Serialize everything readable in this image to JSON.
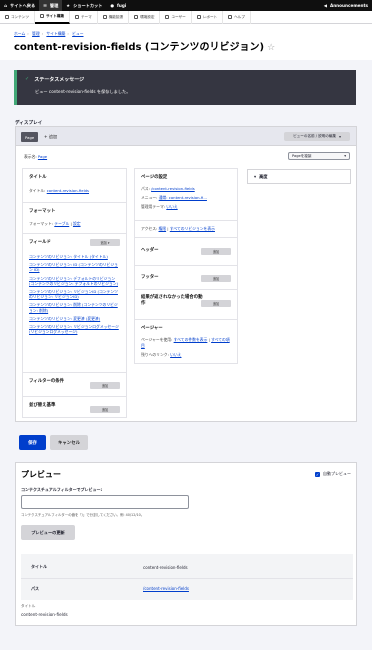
{
  "toolbar": {
    "back": "サイトへ戻る",
    "manage": "管理",
    "shortcuts": "ショートカット",
    "user": "fugi",
    "announcements": "Announcements"
  },
  "tray": [
    "コンテンツ",
    "サイト構築",
    "テーマ",
    "機能拡張",
    "環境設定",
    "ユーザー",
    "レポート",
    "ヘルプ"
  ],
  "breadcrumb": [
    "ホーム",
    "管理",
    "サイト構築",
    "ビュー"
  ],
  "page_title": "content-revision-fields (コンテンツのリビジョン)",
  "status": {
    "heading": "ステータスメッセージ",
    "body": "ビュー content-revision-fields を保存しました。"
  },
  "display_label": "ディスプレイ",
  "display_tab": "Page",
  "add_link": "+ 追加",
  "edit_view_dropdown": "ビューの名前 / 説明の編集",
  "display_name_label": "表示名:",
  "display_name_value": "Page",
  "page_dropdown": "Pageを複製",
  "left": {
    "title_section": "タイトル",
    "title_label": "タイトル:",
    "title_value": "content-revision-fields",
    "format_section": "フォーマット",
    "format_label": "フォーマット:",
    "format_value": "テーブル",
    "format_settings": "設定",
    "fields_section": "フィールド",
    "fields_add": "追加",
    "fields": [
      "コンテンツのリビジョン: タイトル (タイトル)",
      "コンテンツのリビジョン: ID (コンテンツのリビジョン ID)",
      "コンテンツのリビジョン: デフォルトのリビジョン (コンテンツのリビジョン: デフォルトのリビジョン)",
      "コンテンツのリビジョン: リビジョンID (コンテンツのリビジョン: リビジョンID)",
      "コンテンツのリビジョン: 削除 (コンテンツのリビジョン: 削除)",
      "コンテンツのリビジョン: 変更済 (変更済)",
      "コンテンツのリビジョン: リビジョンログメッセージ (リビジョンログメッセージ)"
    ],
    "filter_section": "フィルターの条件",
    "sort_section": "並び替え基準",
    "add": "追加"
  },
  "middle": {
    "page_settings": "ページの設定",
    "path_label": "パス:",
    "path_value": "/content-revision-fields",
    "menu_label": "メニュー:",
    "menu_value": "通常: content-revision-fi...",
    "theme_label": "管理用テーマ:",
    "theme_value": "いいえ",
    "access_label": "アクセス:",
    "access_value": "権限",
    "access_value2": "すべてのリビジョンを表示",
    "header_section": "ヘッダー",
    "footer_section": "フッター",
    "no_results_section": "結果が返されなかった場合の動作",
    "pager_section": "ページャー",
    "pager_label": "ページャーを使用:",
    "pager_value": "すべての件数を表示",
    "pager_value2": "すべての項目",
    "more_label": "残りへのリンク:",
    "more_value": "いいえ",
    "add": "追加"
  },
  "advanced": "高度",
  "save": "保存",
  "cancel": "キャンセル",
  "preview": {
    "heading": "プレビュー",
    "auto_preview": "自動プレビュー",
    "contextual_label": "コンテクスチュアルフィルターでプレビュー:",
    "contextual_help": "コンテクスチュアルフィルターの値を「/」で分割してください。例: 40/12/10。",
    "update": "プレビューの更新",
    "rows": [
      {
        "key": "タイトル",
        "value": "content-revision-fields"
      },
      {
        "key": "パス",
        "value": "/content-revision-fields"
      }
    ],
    "title_label": "タイトル",
    "title_value": "content-revision-fields"
  }
}
